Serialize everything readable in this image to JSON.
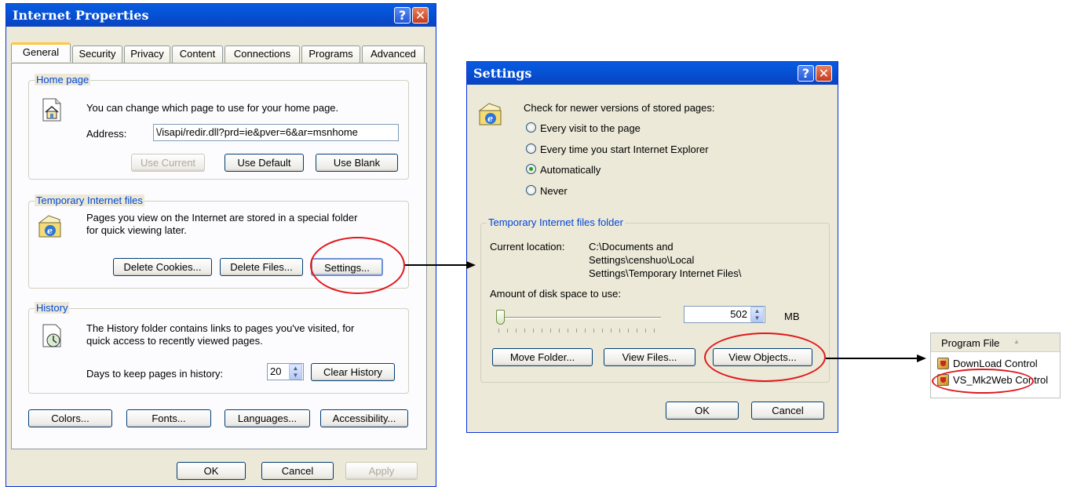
{
  "internet_properties": {
    "title": "Internet Properties",
    "tabs": [
      "General",
      "Security",
      "Privacy",
      "Content",
      "Connections",
      "Programs",
      "Advanced"
    ],
    "home_page": {
      "group_label": "Home page",
      "description": "You can change which page to use for your home page.",
      "address_label": "Address:",
      "address_value": "\\/isapi/redir.dll?prd=ie&pver=6&ar=msnhome",
      "use_current": "Use Current",
      "use_default": "Use Default",
      "use_blank": "Use Blank"
    },
    "temp_files": {
      "group_label": "Temporary Internet files",
      "description_1": "Pages you view on the Internet are stored in a special folder",
      "description_2": "for quick viewing later.",
      "delete_cookies": "Delete Cookies...",
      "delete_files": "Delete Files...",
      "settings": "Settings..."
    },
    "history": {
      "group_label": "History",
      "description_1": "The History folder contains links to pages you've visited, for",
      "description_2": "quick access to recently viewed pages.",
      "days_label": "Days to keep pages in history:",
      "days_value": "20",
      "clear_history": "Clear History"
    },
    "bottom_buttons": {
      "colors": "Colors...",
      "fonts": "Fonts...",
      "languages": "Languages...",
      "accessibility": "Accessibility..."
    },
    "dialog_buttons": {
      "ok": "OK",
      "cancel": "Cancel",
      "apply": "Apply"
    }
  },
  "settings_dialog": {
    "title": "Settings",
    "check_label": "Check for newer versions of stored pages:",
    "options": [
      "Every visit to the page",
      "Every time you start Internet Explorer",
      "Automatically",
      "Never"
    ],
    "selected_option": "Automatically",
    "temp_folder": {
      "group_label": "Temporary Internet files folder",
      "current_location_label": "Current location:",
      "location_line_1": "C:\\Documents and",
      "location_line_2": "Settings\\censhuo\\Local",
      "location_line_3": "Settings\\Temporary Internet Files\\",
      "disk_space_label": "Amount of disk space to use:",
      "disk_space_value": "502",
      "unit": "MB",
      "move_folder": "Move Folder...",
      "view_files": "View Files...",
      "view_objects": "View Objects..."
    },
    "ok": "OK",
    "cancel": "Cancel"
  },
  "program_files": {
    "header": "Program File",
    "items": [
      "DownLoad Control",
      "VS_Mk2Web Control"
    ]
  },
  "colors": {
    "title_bar": "#0553d6",
    "dialog_bg": "#ece9d8",
    "highlight_circle": "#e0181b",
    "group_label": "#0046d5"
  }
}
